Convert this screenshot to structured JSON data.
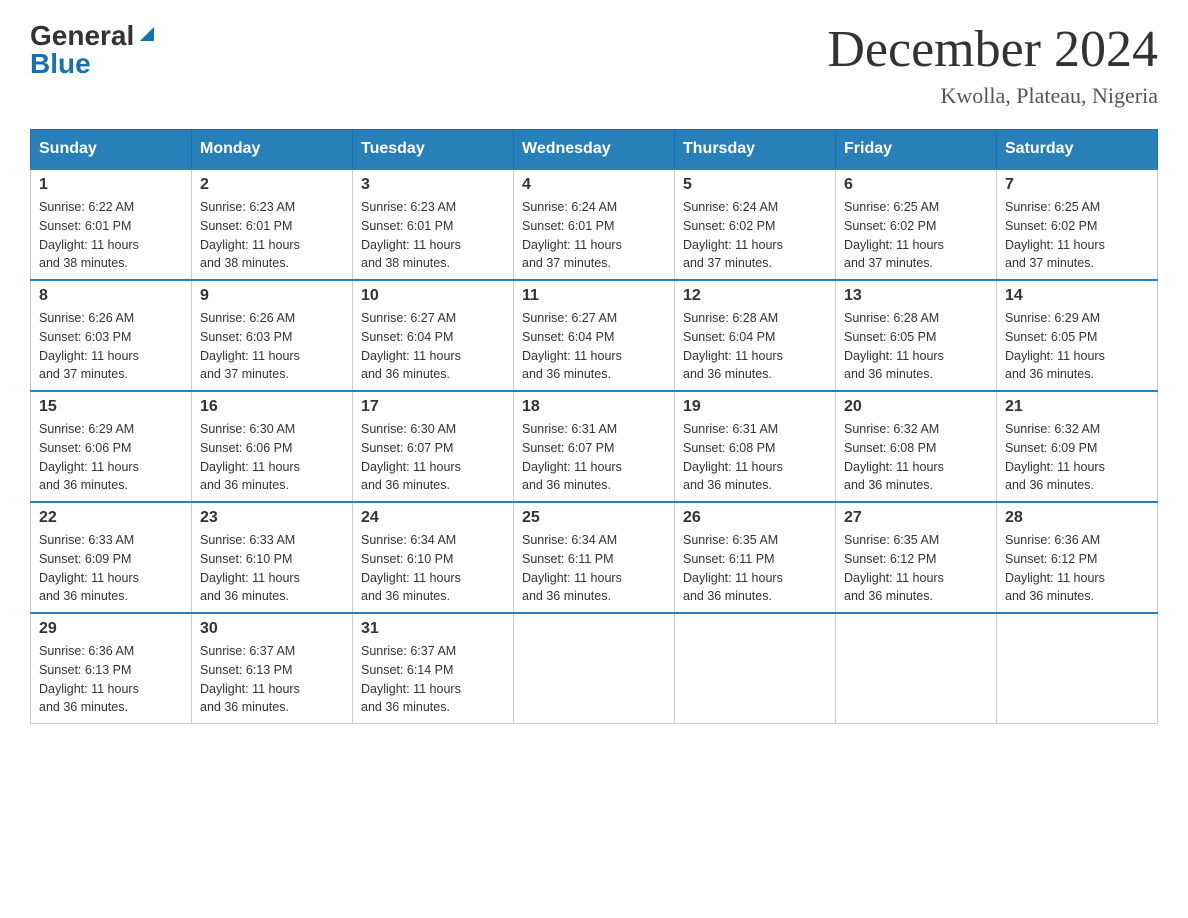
{
  "logo": {
    "general": "General",
    "blue": "Blue"
  },
  "title": "December 2024",
  "location": "Kwolla, Plateau, Nigeria",
  "days_of_week": [
    "Sunday",
    "Monday",
    "Tuesday",
    "Wednesday",
    "Thursday",
    "Friday",
    "Saturday"
  ],
  "weeks": [
    [
      {
        "day": "1",
        "sunrise": "6:22 AM",
        "sunset": "6:01 PM",
        "daylight": "11 hours and 38 minutes."
      },
      {
        "day": "2",
        "sunrise": "6:23 AM",
        "sunset": "6:01 PM",
        "daylight": "11 hours and 38 minutes."
      },
      {
        "day": "3",
        "sunrise": "6:23 AM",
        "sunset": "6:01 PM",
        "daylight": "11 hours and 38 minutes."
      },
      {
        "day": "4",
        "sunrise": "6:24 AM",
        "sunset": "6:01 PM",
        "daylight": "11 hours and 37 minutes."
      },
      {
        "day": "5",
        "sunrise": "6:24 AM",
        "sunset": "6:02 PM",
        "daylight": "11 hours and 37 minutes."
      },
      {
        "day": "6",
        "sunrise": "6:25 AM",
        "sunset": "6:02 PM",
        "daylight": "11 hours and 37 minutes."
      },
      {
        "day": "7",
        "sunrise": "6:25 AM",
        "sunset": "6:02 PM",
        "daylight": "11 hours and 37 minutes."
      }
    ],
    [
      {
        "day": "8",
        "sunrise": "6:26 AM",
        "sunset": "6:03 PM",
        "daylight": "11 hours and 37 minutes."
      },
      {
        "day": "9",
        "sunrise": "6:26 AM",
        "sunset": "6:03 PM",
        "daylight": "11 hours and 37 minutes."
      },
      {
        "day": "10",
        "sunrise": "6:27 AM",
        "sunset": "6:04 PM",
        "daylight": "11 hours and 36 minutes."
      },
      {
        "day": "11",
        "sunrise": "6:27 AM",
        "sunset": "6:04 PM",
        "daylight": "11 hours and 36 minutes."
      },
      {
        "day": "12",
        "sunrise": "6:28 AM",
        "sunset": "6:04 PM",
        "daylight": "11 hours and 36 minutes."
      },
      {
        "day": "13",
        "sunrise": "6:28 AM",
        "sunset": "6:05 PM",
        "daylight": "11 hours and 36 minutes."
      },
      {
        "day": "14",
        "sunrise": "6:29 AM",
        "sunset": "6:05 PM",
        "daylight": "11 hours and 36 minutes."
      }
    ],
    [
      {
        "day": "15",
        "sunrise": "6:29 AM",
        "sunset": "6:06 PM",
        "daylight": "11 hours and 36 minutes."
      },
      {
        "day": "16",
        "sunrise": "6:30 AM",
        "sunset": "6:06 PM",
        "daylight": "11 hours and 36 minutes."
      },
      {
        "day": "17",
        "sunrise": "6:30 AM",
        "sunset": "6:07 PM",
        "daylight": "11 hours and 36 minutes."
      },
      {
        "day": "18",
        "sunrise": "6:31 AM",
        "sunset": "6:07 PM",
        "daylight": "11 hours and 36 minutes."
      },
      {
        "day": "19",
        "sunrise": "6:31 AM",
        "sunset": "6:08 PM",
        "daylight": "11 hours and 36 minutes."
      },
      {
        "day": "20",
        "sunrise": "6:32 AM",
        "sunset": "6:08 PM",
        "daylight": "11 hours and 36 minutes."
      },
      {
        "day": "21",
        "sunrise": "6:32 AM",
        "sunset": "6:09 PM",
        "daylight": "11 hours and 36 minutes."
      }
    ],
    [
      {
        "day": "22",
        "sunrise": "6:33 AM",
        "sunset": "6:09 PM",
        "daylight": "11 hours and 36 minutes."
      },
      {
        "day": "23",
        "sunrise": "6:33 AM",
        "sunset": "6:10 PM",
        "daylight": "11 hours and 36 minutes."
      },
      {
        "day": "24",
        "sunrise": "6:34 AM",
        "sunset": "6:10 PM",
        "daylight": "11 hours and 36 minutes."
      },
      {
        "day": "25",
        "sunrise": "6:34 AM",
        "sunset": "6:11 PM",
        "daylight": "11 hours and 36 minutes."
      },
      {
        "day": "26",
        "sunrise": "6:35 AM",
        "sunset": "6:11 PM",
        "daylight": "11 hours and 36 minutes."
      },
      {
        "day": "27",
        "sunrise": "6:35 AM",
        "sunset": "6:12 PM",
        "daylight": "11 hours and 36 minutes."
      },
      {
        "day": "28",
        "sunrise": "6:36 AM",
        "sunset": "6:12 PM",
        "daylight": "11 hours and 36 minutes."
      }
    ],
    [
      {
        "day": "29",
        "sunrise": "6:36 AM",
        "sunset": "6:13 PM",
        "daylight": "11 hours and 36 minutes."
      },
      {
        "day": "30",
        "sunrise": "6:37 AM",
        "sunset": "6:13 PM",
        "daylight": "11 hours and 36 minutes."
      },
      {
        "day": "31",
        "sunrise": "6:37 AM",
        "sunset": "6:14 PM",
        "daylight": "11 hours and 36 minutes."
      },
      null,
      null,
      null,
      null
    ]
  ],
  "labels": {
    "sunrise": "Sunrise:",
    "sunset": "Sunset:",
    "daylight": "Daylight:"
  }
}
